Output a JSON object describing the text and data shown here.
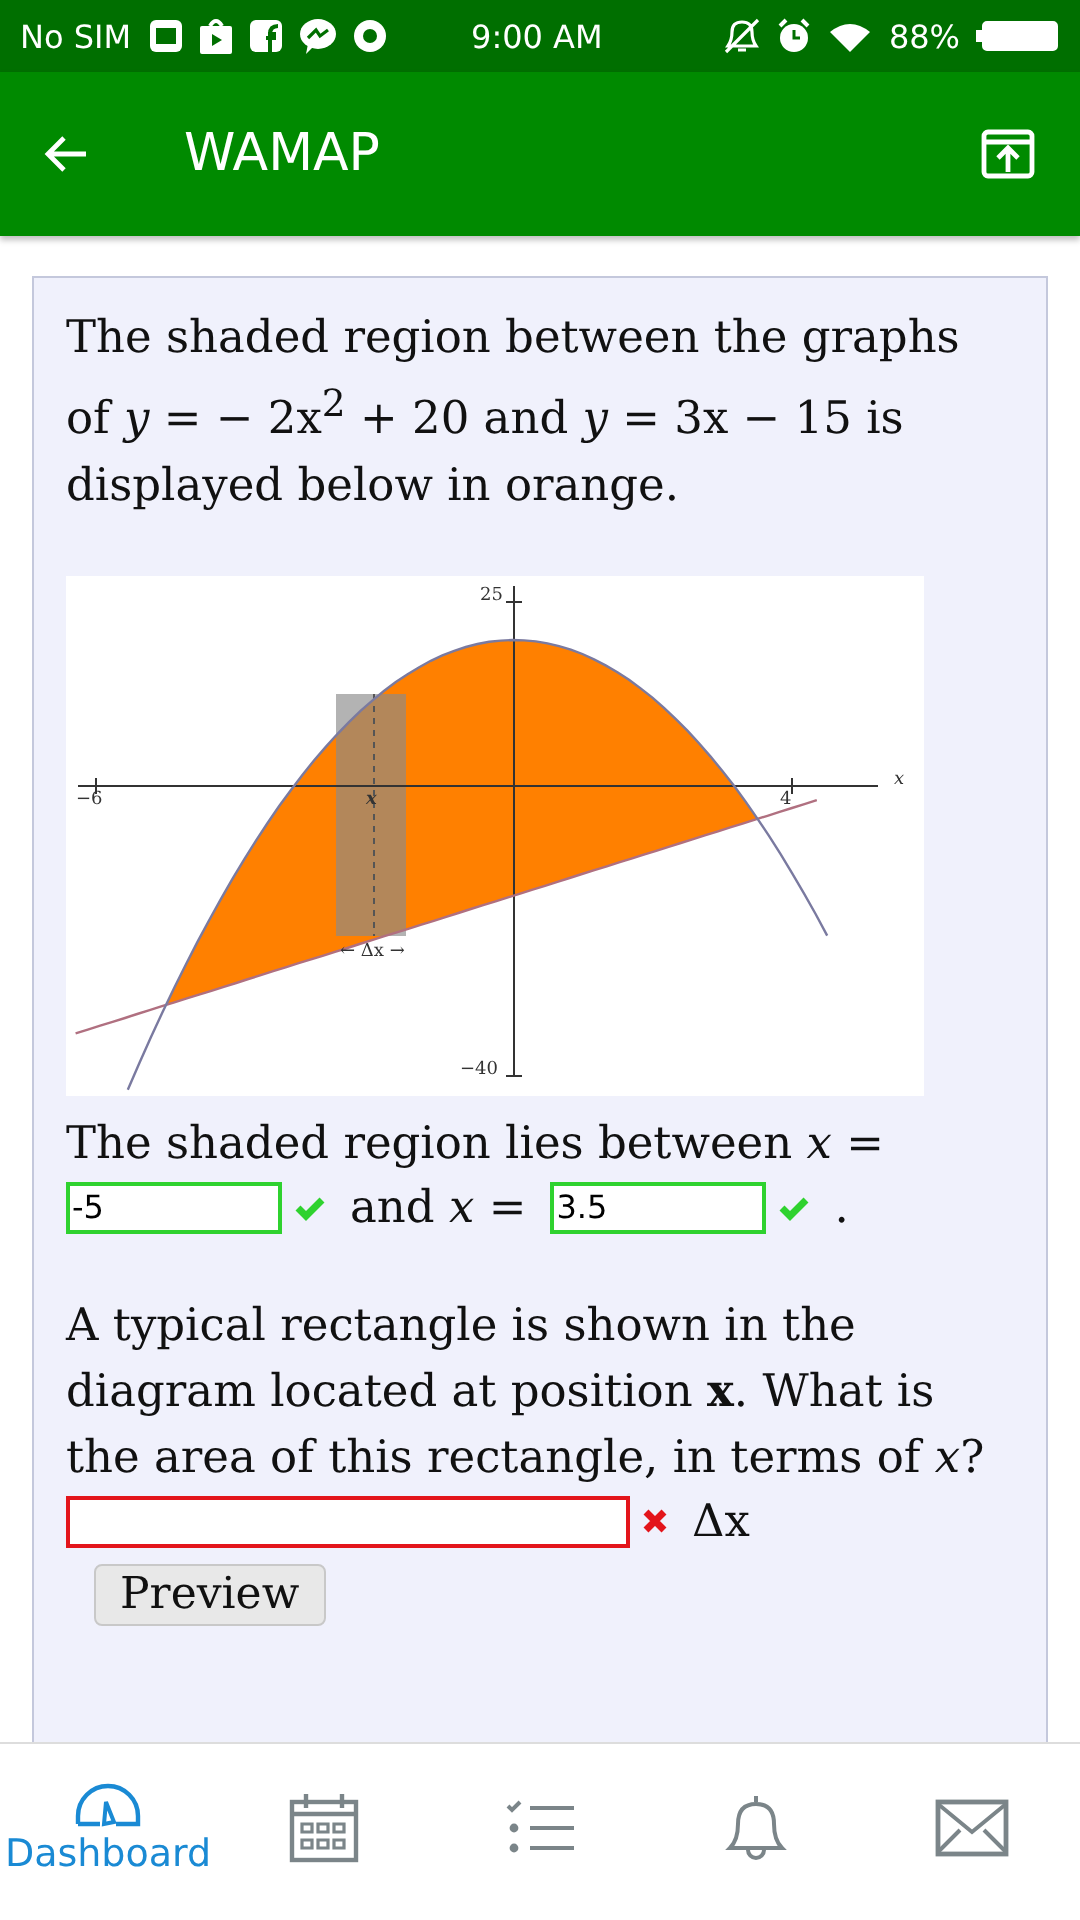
{
  "status_bar": {
    "carrier": "No SIM",
    "time": "9:00 AM",
    "battery": "88%"
  },
  "app_bar": {
    "title": "WAMAP"
  },
  "question": {
    "intro": "The shaded region between the graphs of *y* = − 2x$^{2}$ + 20 and *y* = 3x − 15 is displayed below in orange.",
    "graph": {
      "x_tick_labels": [
        "−6",
        "4"
      ],
      "y_tick_labels": [
        "25",
        "−40"
      ],
      "axis_label": "x",
      "position_label": "x",
      "width_label": "← Δx →"
    },
    "bounds_sentence": "The shaded region lies between *x* =",
    "bound_fields": [
      {
        "value": "-5",
        "correct": true
      },
      {
        "value": "3.5",
        "correct": true
      }
    ],
    "between_text": "and *x* =",
    "end_text": ".",
    "area_prompt": "A typical rectangle is shown in the diagram located at position **x**. What is the area of this rectangle, in terms of *x*?",
    "area_field": {
      "correct": false
    },
    "area_suffix": "Δx",
    "preview_button": "Preview"
  },
  "bottom_nav": [
    {
      "kind": "dashboard",
      "label": "Dashboard",
      "selected": true
    },
    {
      "kind": "calendar",
      "selected": false
    },
    {
      "kind": "checklist",
      "selected": false
    },
    {
      "kind": "bell",
      "selected": false
    },
    {
      "kind": "mail",
      "selected": false
    }
  ]
}
